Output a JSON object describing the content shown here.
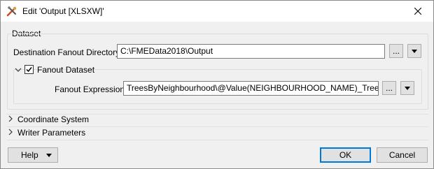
{
  "window": {
    "title": "Edit 'Output [XLSXW]'"
  },
  "dataset": {
    "section_label": "Dataset",
    "destination_label": "Destination Fanout Directory:",
    "destination_value": "C:\\FMEData2018\\Output",
    "browse_label": "...",
    "fanout_dataset_label": "Fanout Dataset",
    "fanout_dataset_checked": true,
    "fanout_expression_label": "Fanout Expression:",
    "fanout_expression_value": "TreesByNeighbourhood\\@Value(NEIGHBOURHOOD_NAME)_Trees.xlsx"
  },
  "sections": {
    "coordinate_system": "Coordinate System",
    "writer_parameters": "Writer Parameters"
  },
  "footer": {
    "help_label": "Help",
    "ok_label": "OK",
    "cancel_label": "Cancel"
  },
  "icons": {
    "app": "fme-workbench-icon",
    "close": "close-icon",
    "dropdown": "triangle-down-icon",
    "chevron_down": "chevron-down-icon",
    "chevron_right": "chevron-right-icon",
    "checkmark": "checkmark-icon"
  },
  "colors": {
    "ok_border": "#0078d7",
    "background": "#f0f0f0"
  }
}
